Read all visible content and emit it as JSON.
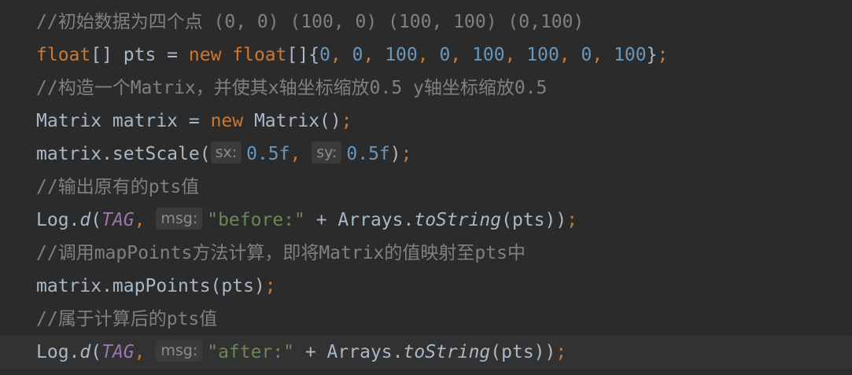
{
  "lines": [
    {
      "comment": "//初始数据为四个点 (0, 0) (100, 0) (100, 100) (0,100)"
    },
    {
      "t": [
        "float",
        "[] pts = ",
        "new ",
        "float",
        "[]{",
        "0",
        ", ",
        "0",
        ", ",
        "100",
        ", ",
        "0",
        ", ",
        "100",
        ", ",
        "100",
        ", ",
        "0",
        ", ",
        "100",
        "}",
        ";"
      ]
    },
    {
      "comment": "//构造一个Matrix，并使其x轴坐标缩放0.5 y轴坐标缩放0.5"
    },
    {
      "t": [
        "Matrix matrix = ",
        "new ",
        "Matrix()",
        ";"
      ]
    },
    {
      "t": [
        "matrix.setScale(",
        "sx:",
        "0.5f",
        ", ",
        "sy:",
        "0.5f",
        ")",
        ";"
      ]
    },
    {
      "comment": "//输出原有的pts值"
    },
    {
      "t": [
        "Log.",
        "d",
        "(",
        "TAG",
        ", ",
        "msg:",
        "\"before:\"",
        " + Arrays.",
        "toString",
        "(pts))",
        ";"
      ]
    },
    {
      "comment": "//调用mapPoints方法计算，即将Matrix的值映射至pts中"
    },
    {
      "t": [
        "matrix.mapPoints(pts)",
        ";"
      ]
    },
    {
      "comment": "//属于计算后的pts值"
    },
    {
      "t": [
        "Log.",
        "d",
        "(",
        "TAG",
        ", ",
        "msg:",
        "\"after:\"",
        " + Arrays.",
        "toString",
        "(pts))",
        ";"
      ]
    }
  ],
  "colors": {
    "background": "#2b2b2b",
    "current_line": "#323232",
    "default_text": "#a9b7c6",
    "comment": "#808080",
    "keyword": "#cc7832",
    "number": "#6897bb",
    "string": "#6a8759",
    "field": "#9876aa",
    "hint_bg": "#3b3b3b",
    "hint_text": "#8c8c8c"
  }
}
